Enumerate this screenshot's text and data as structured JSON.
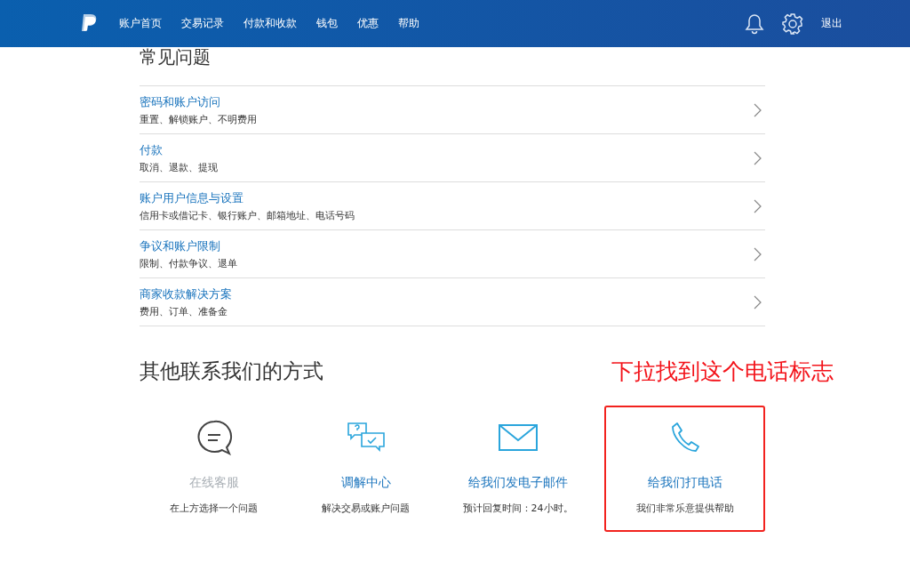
{
  "nav": {
    "items": [
      "账户首页",
      "交易记录",
      "付款和收款",
      "钱包",
      "优惠",
      "帮助"
    ],
    "logout": "退出"
  },
  "faq": {
    "title": "常见问题",
    "items": [
      {
        "title": "密码和账户访问",
        "subtitle": "重置、解锁账户、不明费用"
      },
      {
        "title": "付款",
        "subtitle": "取消、退款、提现"
      },
      {
        "title": "账户用户信息与设置",
        "subtitle": "信用卡或借记卡、银行账户、邮箱地址、电话号码"
      },
      {
        "title": "争议和账户限制",
        "subtitle": "限制、付款争议、退单"
      },
      {
        "title": "商家收款解决方案",
        "subtitle": "费用、订单、准备金"
      }
    ]
  },
  "contact": {
    "title": "其他联系我们的方式",
    "annotation": "下拉找到这个电话标志",
    "options": [
      {
        "kind": "chat",
        "title": "在线客服",
        "subtitle": "在上方选择一个问题",
        "disabled": true,
        "highlighted": false
      },
      {
        "kind": "resolution",
        "title": "调解中心",
        "subtitle": "解决交易或账户问题",
        "disabled": false,
        "highlighted": false
      },
      {
        "kind": "email",
        "title": "给我们发电子邮件",
        "subtitle": "预计回复时间：24小时。",
        "disabled": false,
        "highlighted": false
      },
      {
        "kind": "phone",
        "title": "给我们打电话",
        "subtitle": "我们非常乐意提供帮助",
        "disabled": false,
        "highlighted": true
      }
    ]
  }
}
